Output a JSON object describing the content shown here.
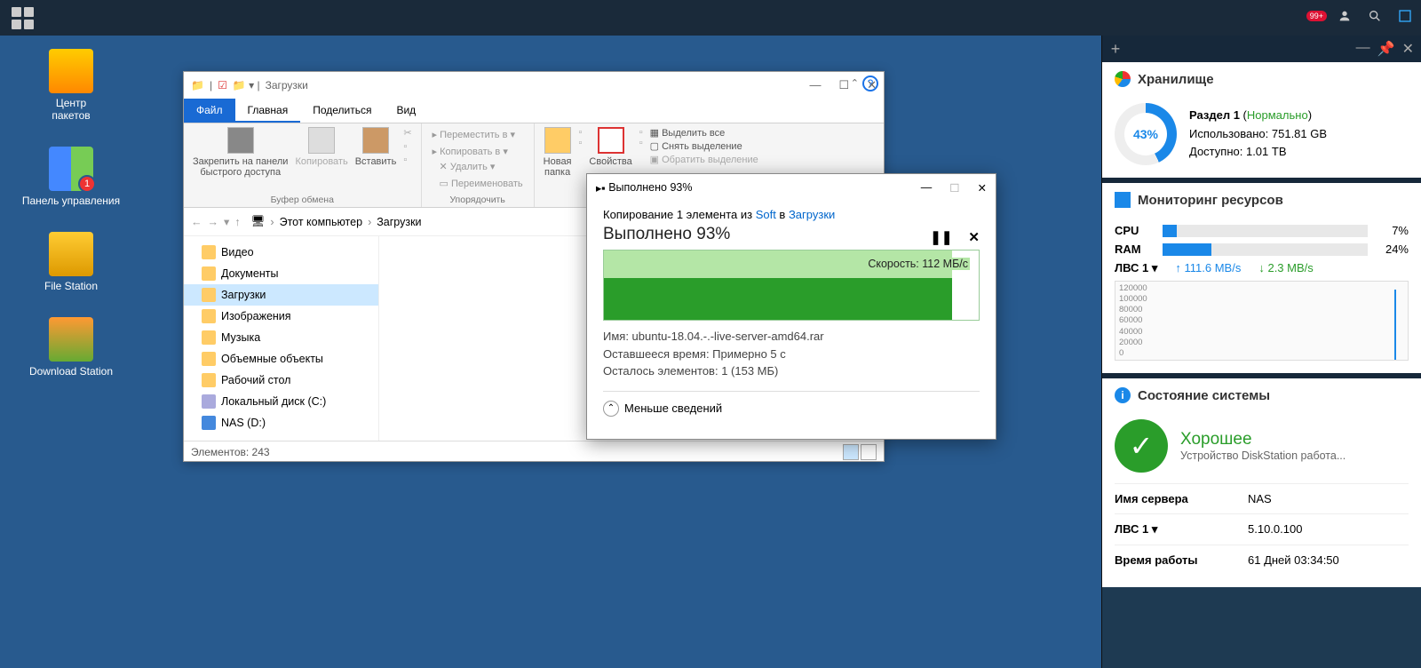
{
  "topbar": {
    "notify_badge": "99+"
  },
  "desktop": [
    {
      "label": "Центр\nпакетов",
      "key": "pkg"
    },
    {
      "label": "Панель управления",
      "key": "ctrl",
      "badge": "1"
    },
    {
      "label": "File Station",
      "key": "fs"
    },
    {
      "label": "Download Station",
      "key": "dl"
    }
  ],
  "explorer": {
    "title": "Загрузки",
    "tabs": [
      "Файл",
      "Главная",
      "Поделиться",
      "Вид"
    ],
    "active_tab": 1,
    "ribbon": {
      "pin": "Закрепить на панели\nбыстрого доступа",
      "copy": "Копировать",
      "paste": "Вставить",
      "group1": "Буфер обмена",
      "move_to": "Переместить в",
      "copy_to": "Копировать в",
      "delete": "Удалить",
      "rename": "Переименовать",
      "group2": "Упорядочить",
      "new_folder": "Новая\nпапка",
      "properties": "Свойства",
      "select_all": "Выделить все",
      "deselect": "Снять выделение",
      "invert": "Обратить выделение"
    },
    "breadcrumb": [
      "Этот компьютер",
      "Загрузки"
    ],
    "sidebar": [
      {
        "label": "Видео"
      },
      {
        "label": "Документы"
      },
      {
        "label": "Загрузки",
        "sel": true
      },
      {
        "label": "Изображения"
      },
      {
        "label": "Музыка"
      },
      {
        "label": "Объемные объекты"
      },
      {
        "label": "Рабочий стол"
      },
      {
        "label": "Локальный диск (C:)",
        "type": "disk"
      },
      {
        "label": "NAS (D:)",
        "type": "nas"
      }
    ],
    "status": "Элементов: 243"
  },
  "copydialog": {
    "title": "Выполнено 93%",
    "from_prefix": "Копирование 1 элемента из ",
    "from_src": "Soft",
    "from_mid": " в ",
    "from_dst": "Загрузки",
    "percent": "Выполнено 93%",
    "speed": "Скорость: 112 МБ/с",
    "name_label": "Имя: ",
    "name_val": "ubuntu-18.04.-.-live-server-amd64.rar",
    "time_label": "Оставшееся время: ",
    "time_val": "Примерно 5 с",
    "left_label": "Осталось элементов: ",
    "left_val": "1 (153 МБ)",
    "less_details": "Меньше сведений"
  },
  "tray": {
    "storage": {
      "title": "Хранилище",
      "partition": "Раздел 1",
      "status": "Нормально",
      "used_label": "Использовано:",
      "used_val": "751.81 GB",
      "avail_label": "Доступно:",
      "avail_val": "1.01 TB",
      "percent": "43%"
    },
    "monitor": {
      "title": "Мониторинг ресурсов",
      "cpu_label": "CPU",
      "cpu_val": "7%",
      "cpu_pct": 7,
      "ram_label": "RAM",
      "ram_val": "24%",
      "ram_pct": 24,
      "lan_label": "ЛВС 1",
      "up": "111.6 MB/s",
      "down": "2.3 MB/s",
      "axis": [
        "120000",
        "100000",
        "80000",
        "60000",
        "40000",
        "20000",
        "0"
      ]
    },
    "health": {
      "title": "Состояние системы",
      "status": "Хорошее",
      "desc": "Устройство DiskStation работа...",
      "rows": [
        {
          "k": "Имя сервера",
          "v": "NAS"
        },
        {
          "k": "ЛВС 1 ▾",
          "v": "5.10.0.100"
        },
        {
          "k": "Время работы",
          "v": "61 Дней 03:34:50"
        }
      ]
    }
  },
  "chart_data": [
    {
      "type": "pie",
      "title": "Хранилище — Раздел 1",
      "categories": [
        "Использовано",
        "Доступно"
      ],
      "values": [
        751.81,
        1034.24
      ],
      "unit": "GB",
      "used_pct": 43
    },
    {
      "type": "bar",
      "title": "Копирование — скорость",
      "ylabel": "МБ/с",
      "ylim": [
        0,
        130
      ],
      "values": [
        112
      ],
      "progress_pct": 93
    },
    {
      "type": "line",
      "title": "ЛВС 1 — пропускная способность",
      "ylabel": "KB/s",
      "ylim": [
        0,
        120000
      ],
      "series": [
        {
          "name": "Передача",
          "values": [
            0,
            0,
            0,
            0,
            0,
            0,
            0,
            0,
            0,
            0,
            0,
            0,
            0,
            0,
            111600
          ]
        },
        {
          "name": "Приём",
          "values": [
            0,
            0,
            0,
            0,
            0,
            0,
            0,
            0,
            0,
            0,
            0,
            0,
            0,
            0,
            2300
          ]
        }
      ]
    }
  ]
}
